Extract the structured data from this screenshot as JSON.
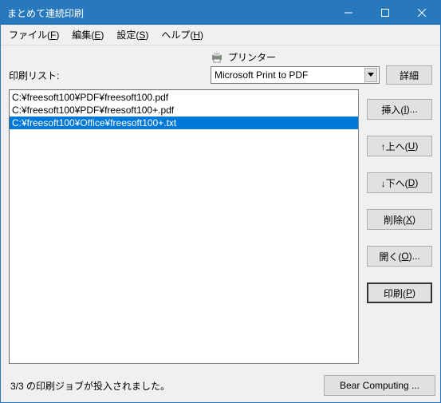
{
  "window": {
    "title": "まとめて連続印刷"
  },
  "menu": {
    "file": {
      "pre": "ファイル(",
      "key": "F",
      "post": ")"
    },
    "edit": {
      "pre": "編集(",
      "key": "E",
      "post": ")"
    },
    "settings": {
      "pre": "設定(",
      "key": "S",
      "post": ")"
    },
    "help": {
      "pre": "ヘルプ(",
      "key": "H",
      "post": ")"
    }
  },
  "labels": {
    "print_list": "印刷リスト:",
    "printer": "プリンター"
  },
  "printer": {
    "selected": "Microsoft Print to PDF"
  },
  "buttons": {
    "detail": "詳細",
    "insert": {
      "pre": "挿入(",
      "key": "I",
      "post": ")..."
    },
    "up": {
      "pre": "↑上へ(",
      "key": "U",
      "post": ")"
    },
    "down": {
      "pre": "↓下へ(",
      "key": "D",
      "post": ")"
    },
    "delete": {
      "pre": "削除(",
      "key": "X",
      "post": ")"
    },
    "open": {
      "pre": "開く(",
      "key": "O",
      "post": ")..."
    },
    "print": {
      "pre": "印刷(",
      "key": "P",
      "post": ")"
    },
    "bear": "Bear Computing ..."
  },
  "list": {
    "items": [
      {
        "text": "C:¥freesoft100¥PDF¥freesoft100.pdf",
        "selected": false
      },
      {
        "text": "C:¥freesoft100¥PDF¥freesoft100+.pdf",
        "selected": false
      },
      {
        "text": "C:¥freesoft100¥Office¥freesoft100+.txt",
        "selected": true
      }
    ]
  },
  "status": "3/3 の印刷ジョブが投入されました。"
}
